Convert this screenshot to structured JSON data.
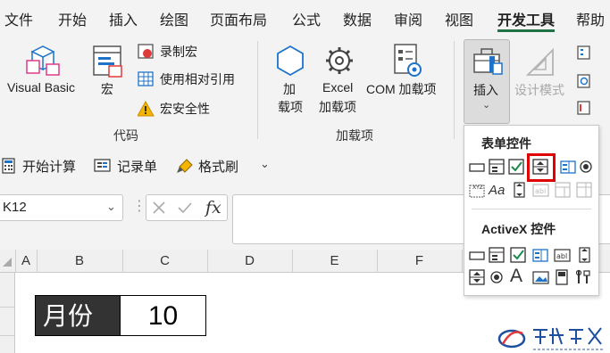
{
  "menu": {
    "tabs": [
      "文件",
      "开始",
      "插入",
      "绘图",
      "页面布局",
      "公式",
      "数据",
      "审阅",
      "视图",
      "开发工具",
      "帮助"
    ],
    "active_tab": "开发工具"
  },
  "ribbon": {
    "code_group": {
      "label": "代码",
      "visual_basic": "Visual Basic",
      "macros": "宏",
      "record_macro": "录制宏",
      "relative_refs": "使用相对引用",
      "macro_security": "宏安全性"
    },
    "addins_group": {
      "label": "加载项",
      "addins_line1": "加",
      "addins_line2": "载项",
      "excel_addins_line1": "Excel",
      "excel_addins_line2": "加载项",
      "com_addins": "COM 加载项"
    },
    "controls_group": {
      "insert": "插入",
      "design_mode": "设计模式"
    }
  },
  "qat": {
    "start_calc": "开始计算",
    "record_form": "记录单",
    "format_painter": "格式刷"
  },
  "formula_bar": {
    "name_box": "K12",
    "fx": "fx",
    "content": ""
  },
  "grid": {
    "columns": [
      "A",
      "B",
      "C",
      "D",
      "E",
      "F"
    ],
    "cells": {
      "month_label": "月份",
      "month_value": "10"
    }
  },
  "insert_dropdown": {
    "form_controls_heading": "表单控件",
    "activex_heading": "ActiveX 控件"
  },
  "colors": {
    "accent": "#217346",
    "highlight": "#e00000",
    "ribbon_bg": "#f3f3f3"
  }
}
